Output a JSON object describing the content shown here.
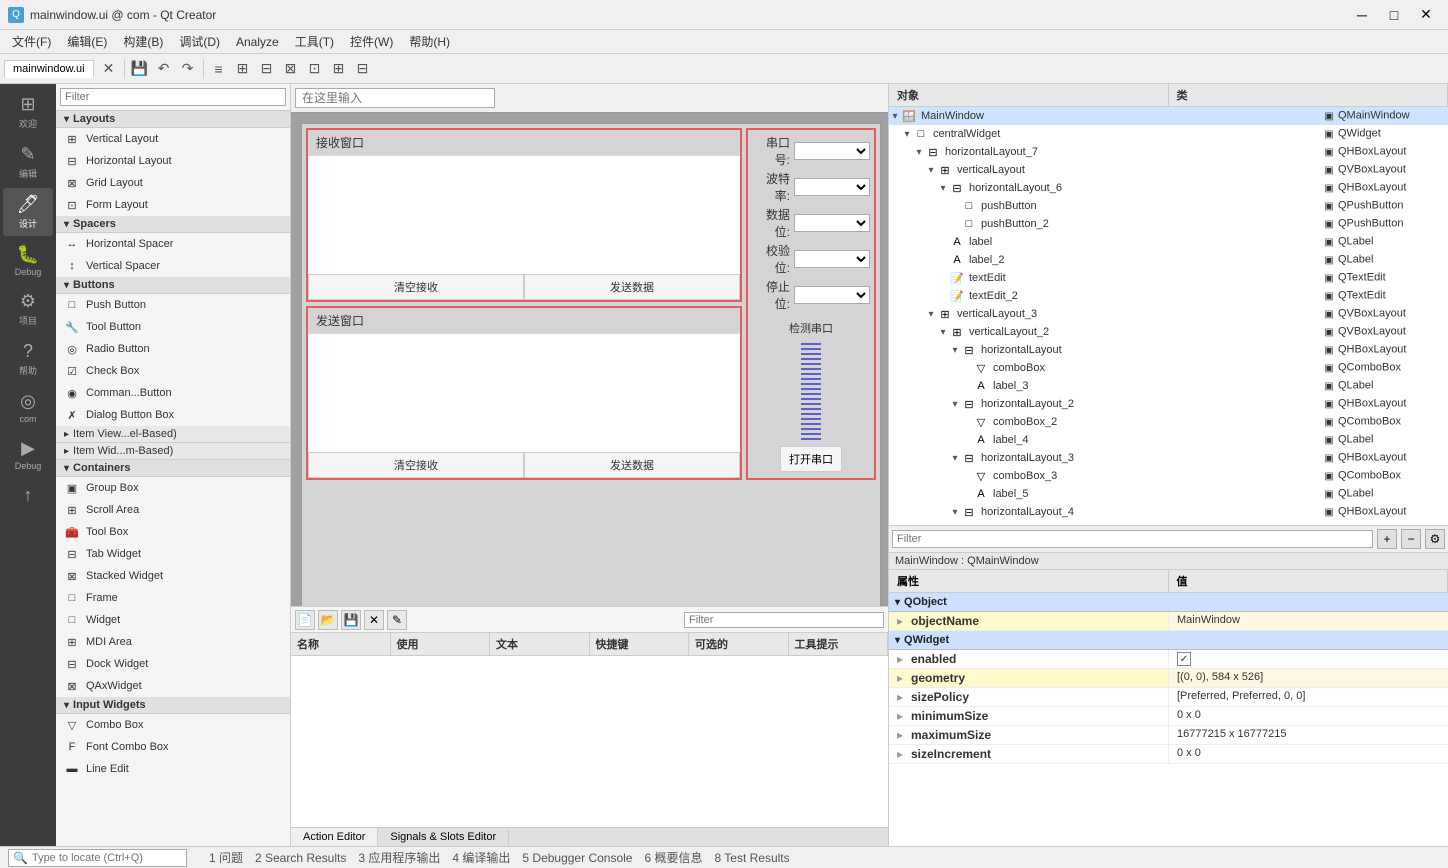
{
  "titleBar": {
    "title": "mainwindow.ui @ com - Qt Creator",
    "icon": "Qt",
    "controls": [
      "minimize",
      "maximize",
      "close"
    ]
  },
  "menuBar": {
    "items": [
      "文件(F)",
      "编辑(E)",
      "构建(B)",
      "调试(D)",
      "Analyze",
      "工具(T)",
      "控件(W)",
      "帮助(H)"
    ]
  },
  "toolbar": {
    "activeTab": "mainwindow.ui",
    "buttons": [
      "save",
      "undo",
      "redo",
      "cut",
      "copy",
      "paste"
    ]
  },
  "widgetPanel": {
    "filterPlaceholder": "Filter",
    "categories": [
      {
        "name": "Layouts",
        "items": [
          {
            "label": "Vertical Layout",
            "icon": "⊞"
          },
          {
            "label": "Horizontal Layout",
            "icon": "⊟"
          },
          {
            "label": "Grid Layout",
            "icon": "⊠"
          },
          {
            "label": "Form Layout",
            "icon": "⊡"
          }
        ]
      },
      {
        "name": "Spacers",
        "items": [
          {
            "label": "Horizontal Spacer",
            "icon": "↔"
          },
          {
            "label": "Vertical Spacer",
            "icon": "↕"
          }
        ]
      },
      {
        "name": "Buttons",
        "items": [
          {
            "label": "Push Button",
            "icon": "□"
          },
          {
            "label": "Tool Button",
            "icon": "🔧"
          },
          {
            "label": "Radio Button",
            "icon": "◎"
          },
          {
            "label": "Check Box",
            "icon": "☑"
          },
          {
            "label": "Comman...Button",
            "icon": "◉"
          },
          {
            "label": "Dialog Button Box",
            "icon": "✗"
          }
        ]
      },
      {
        "name": "Item View...el-Based)",
        "collapsed": true
      },
      {
        "name": "Item Wid...m-Based)",
        "collapsed": true
      },
      {
        "name": "Containers",
        "items": [
          {
            "label": "Group Box",
            "icon": "▣"
          },
          {
            "label": "Scroll Area",
            "icon": "⊞"
          },
          {
            "label": "Tool Box",
            "icon": "🧰"
          },
          {
            "label": "Tab Widget",
            "icon": "⊟"
          },
          {
            "label": "Stacked Widget",
            "icon": "⊠"
          },
          {
            "label": "Frame",
            "icon": "□"
          },
          {
            "label": "Widget",
            "icon": "□"
          },
          {
            "label": "MDI Area",
            "icon": "⊞"
          },
          {
            "label": "Dock Widget",
            "icon": "⊟"
          },
          {
            "label": "QAxWidget",
            "icon": "⊠"
          }
        ]
      },
      {
        "name": "Input Widgets",
        "items": [
          {
            "label": "Combo Box",
            "icon": "▽"
          },
          {
            "label": "Font Combo Box",
            "icon": "F"
          },
          {
            "label": "Line Edit",
            "icon": "▬"
          }
        ]
      }
    ]
  },
  "iconSidebar": {
    "items": [
      {
        "label": "欢迎",
        "icon": "⊞"
      },
      {
        "label": "编辑",
        "icon": "✎"
      },
      {
        "label": "设计",
        "icon": "🖊"
      },
      {
        "label": "Debug",
        "icon": "🐛"
      },
      {
        "label": "项目",
        "icon": "⚙"
      },
      {
        "label": "帮助",
        "icon": "?"
      },
      {
        "label": "com",
        "icon": "◎"
      },
      {
        "label": "Debug",
        "icon": "▶"
      },
      {
        "label": "",
        "icon": "↑"
      }
    ]
  },
  "editorCanvas": {
    "inputPlaceholder": "在这里输入",
    "leftPanel": {
      "title": "接收窗口",
      "buttons": [
        "清空接收",
        "发送数据"
      ]
    },
    "rightPanel": {
      "combos": [
        {
          "label": "串口号:",
          "placeholder": ""
        },
        {
          "label": "波特率:",
          "placeholder": ""
        },
        {
          "label": "数据位:",
          "placeholder": ""
        },
        {
          "label": "校验位:",
          "placeholder": ""
        },
        {
          "label": "停止位:",
          "placeholder": ""
        }
      ],
      "detectTitle": "检测串口",
      "openButton": "打开串口"
    },
    "sendPanel": {
      "title": "发送窗口",
      "buttons": [
        "清空接收",
        "发送数据"
      ]
    }
  },
  "bottomArea": {
    "filterPlaceholder": "Filter",
    "tableHeaders": [
      "名称",
      "使用",
      "文本",
      "快捷键",
      "可选的",
      "工具提示"
    ],
    "tabs": [
      "Action Editor",
      "Signals & Slots Editor"
    ]
  },
  "objectPanel": {
    "headers": [
      "对象",
      "类"
    ],
    "breadcrumb": "MainWindow : QMainWindow",
    "tree": [
      {
        "name": "MainWindow",
        "type": "QMainWindow",
        "indent": 0,
        "expanded": true,
        "icon": "🪟"
      },
      {
        "name": "centralWidget",
        "type": "QWidget",
        "indent": 1,
        "expanded": true,
        "icon": "□"
      },
      {
        "name": "horizontalLayout_7",
        "type": "QHBoxLayout",
        "indent": 2,
        "expanded": true,
        "icon": "⊟"
      },
      {
        "name": "verticalLayout",
        "type": "QVBoxLayout",
        "indent": 3,
        "expanded": true,
        "icon": "⊞"
      },
      {
        "name": "horizontalLayout_6",
        "type": "QHBoxLayout",
        "indent": 4,
        "expanded": true,
        "icon": "⊟"
      },
      {
        "name": "pushButton",
        "type": "QPushButton",
        "indent": 5,
        "icon": "□"
      },
      {
        "name": "pushButton_2",
        "type": "QPushButton",
        "indent": 5,
        "icon": "□"
      },
      {
        "name": "label",
        "type": "QLabel",
        "indent": 4,
        "icon": "A"
      },
      {
        "name": "label_2",
        "type": "QLabel",
        "indent": 4,
        "icon": "A"
      },
      {
        "name": "textEdit",
        "type": "QTextEdit",
        "indent": 4,
        "icon": "📝"
      },
      {
        "name": "textEdit_2",
        "type": "QTextEdit",
        "indent": 4,
        "icon": "📝"
      },
      {
        "name": "verticalLayout_3",
        "type": "QVBoxLayout",
        "indent": 3,
        "expanded": true,
        "icon": "⊞"
      },
      {
        "name": "verticalLayout_2",
        "type": "QVBoxLayout",
        "indent": 4,
        "expanded": true,
        "icon": "⊞"
      },
      {
        "name": "horizontalLayout",
        "type": "QHBoxLayout",
        "indent": 5,
        "expanded": true,
        "icon": "⊟"
      },
      {
        "name": "comboBox",
        "type": "QComboBox",
        "indent": 6,
        "icon": "▽"
      },
      {
        "name": "label_3",
        "type": "QLabel",
        "indent": 6,
        "icon": "A"
      },
      {
        "name": "horizontalLayout_2",
        "type": "QHBoxLayout",
        "indent": 5,
        "expanded": true,
        "icon": "⊟"
      },
      {
        "name": "comboBox_2",
        "type": "QComboBox",
        "indent": 6,
        "icon": "▽"
      },
      {
        "name": "label_4",
        "type": "QLabel",
        "indent": 6,
        "icon": "A"
      },
      {
        "name": "horizontalLayout_3",
        "type": "QHBoxLayout",
        "indent": 5,
        "expanded": true,
        "icon": "⊟"
      },
      {
        "name": "comboBox_3",
        "type": "QComboBox",
        "indent": 6,
        "icon": "▽"
      },
      {
        "name": "label_5",
        "type": "QLabel",
        "indent": 6,
        "icon": "A"
      },
      {
        "name": "horizontalLayout_4",
        "type": "QHBoxLayout",
        "indent": 5,
        "expanded": true,
        "icon": "⊟"
      }
    ]
  },
  "propertiesPanel": {
    "filterPlaceholder": "Filter",
    "breadcrumb": "MainWindow : QMainWindow",
    "headers": [
      "属性",
      "值"
    ],
    "groups": [
      {
        "name": "QObject",
        "rows": [
          {
            "key": "objectName",
            "value": "MainWindow",
            "highlighted": true
          }
        ]
      },
      {
        "name": "QWidget",
        "rows": [
          {
            "key": "enabled",
            "value": "✓checkbox",
            "highlighted": false
          },
          {
            "key": "geometry",
            "value": "[(0, 0), 584 x 526]",
            "highlighted": true
          },
          {
            "key": "sizePolicy",
            "value": "[Preferred, Preferred, 0, 0]",
            "highlighted": false
          },
          {
            "key": "minimumSize",
            "value": "0 x 0",
            "highlighted": false
          },
          {
            "key": "maximumSize",
            "value": "16777215 x 16777215",
            "highlighted": false
          },
          {
            "key": "sizeIncrement",
            "value": "0 x 0",
            "highlighted": false
          }
        ]
      }
    ]
  },
  "statusBar": {
    "searchPlaceholder": "Type to locate (Ctrl+Q)",
    "items": [
      {
        "num": 1,
        "label": "问题"
      },
      {
        "num": 2,
        "label": "Search Results"
      },
      {
        "num": 3,
        "label": "应用程序输出"
      },
      {
        "num": 4,
        "label": "编译输出"
      },
      {
        "num": 5,
        "label": "Debugger Console"
      },
      {
        "num": 6,
        "label": "概要信息"
      },
      {
        "num": 8,
        "label": "Test Results"
      }
    ]
  }
}
